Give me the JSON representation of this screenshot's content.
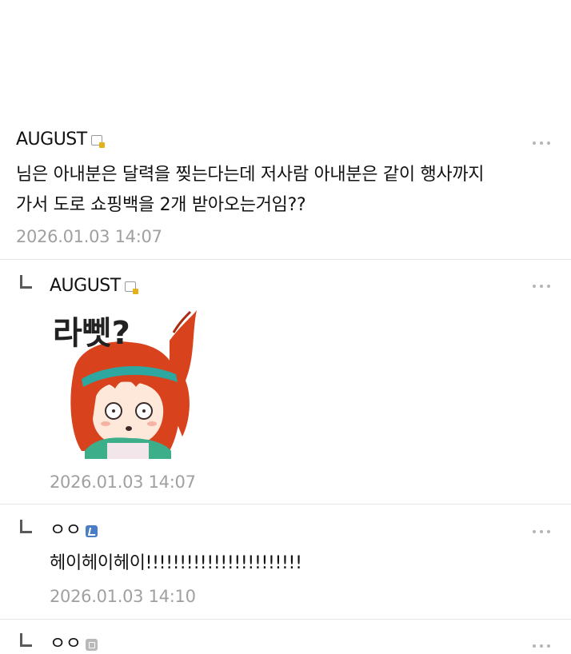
{
  "comments": [
    {
      "author": "AUGUST",
      "badge": "memo-badge-icon",
      "text_lines": [
        "님은 아내분은 달력을 찢는다는데 저사람 아내분은 같이 행사까지",
        "가서 도로 쇼핑백을 2개 받아오는거임??"
      ],
      "timestamp": "2026.01.03 14:07"
    },
    {
      "author": "AUGUST",
      "badge": "memo-badge-icon",
      "sticker_text": "라뻿?",
      "sticker_colors": {
        "hair": "#d8421d",
        "band": "#2ea7a0",
        "shirt": "#3cae8a",
        "skin": "#fde8da"
      },
      "timestamp": "2026.01.03 14:07"
    },
    {
      "author": "ㅇㅇ",
      "badge": "verified-badge-icon",
      "text": "헤이헤이헤이!!!!!!!!!!!!!!!!!!!!!!!",
      "timestamp": "2026.01.03 14:10"
    },
    {
      "author": "ㅇㅇ",
      "badge": "gray-badge-icon"
    }
  ],
  "colors": {
    "text": "#111111",
    "timestamp": "#a0a0a0",
    "divider": "#e6e6e6",
    "dots": "#b5b5b5"
  }
}
